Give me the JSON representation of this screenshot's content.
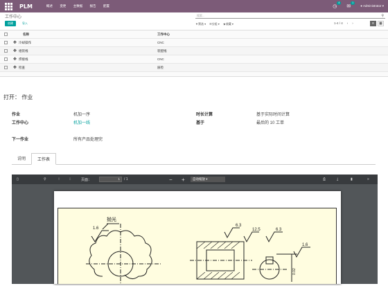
{
  "topbar": {
    "brand": "PLM",
    "menu": [
      "概述",
      "变更",
      "主数据",
      "报告",
      "配置"
    ],
    "notif_count": "4",
    "chat_count": "1",
    "user": "Administrator"
  },
  "control_panel": {
    "breadcrumb": "工作中心",
    "search_placeholder": "搜索...",
    "create_label": "创建",
    "import_label": "导入",
    "filters_label": "筛选",
    "group_label": "分组",
    "favorites_label": "收藏",
    "pager": "1-4 / 4"
  },
  "list": {
    "headers": [
      "名称",
      "工作中心"
    ],
    "rows": [
      {
        "name": "冷却操作",
        "center": "CNC"
      },
      {
        "name": "组装线",
        "center": "装配线"
      },
      {
        "name": "焊接线",
        "center": "CNC"
      },
      {
        "name": "检查",
        "center": "质检"
      }
    ]
  },
  "form": {
    "title": "打开： 作业",
    "fields": {
      "operation_label": "作业",
      "operation_value": "机加一序",
      "workcenter_label": "工作中心",
      "workcenter_value": "机加一线",
      "next_label": "下一作业",
      "next_value": "所有产品处理完",
      "duration_label": "时长计算",
      "duration_value": "基于实际时间计算",
      "based_label": "基于",
      "based_value": "最后的 10 工单"
    },
    "tabs": [
      "说明",
      "工作表"
    ]
  },
  "pdf": {
    "page_label": "页面：",
    "page_current": "1",
    "page_total": "/ 1",
    "zoom": "自动缩放",
    "drawing_labels": [
      "抛光",
      "1.6",
      "6.3",
      "12.5",
      "6.3",
      "1.6",
      "0.02"
    ]
  },
  "colors": {
    "brand": "#7c5b78",
    "accent": "#00a09d",
    "viewer_bg": "#525659",
    "toolbar": "#383b3e"
  }
}
